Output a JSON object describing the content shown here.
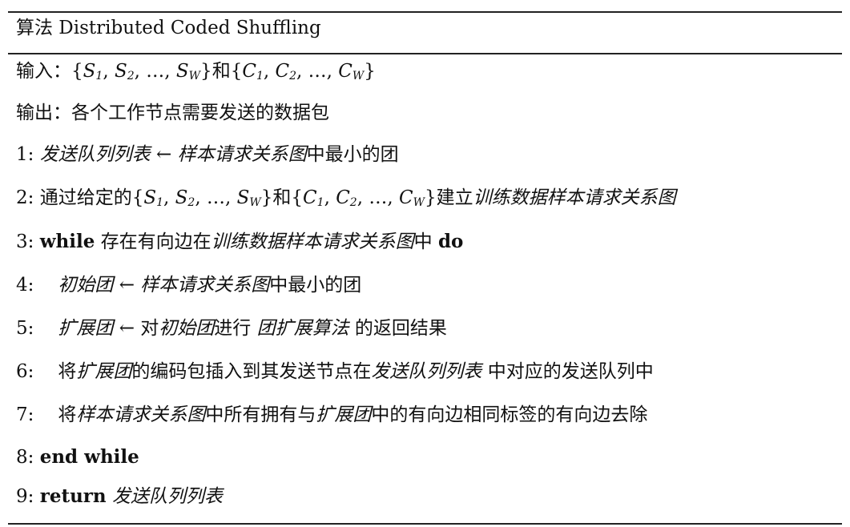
{
  "title": "算法 Distributed Coded Shuffling",
  "input_label": "输入：",
  "and": "和",
  "set_s": {
    "open": "{",
    "s1": "S",
    "sub1": "1",
    "s2": "S",
    "sub2": "2",
    "dots": "…",
    "sw": "S",
    "subw": "W",
    "close": "}"
  },
  "set_c": {
    "open": "{",
    "c1": "C",
    "sub1": "1",
    "c2": "C",
    "sub2": "2",
    "dots": "…",
    "cw": "C",
    "subw": "W",
    "close": "}"
  },
  "output_text": "输出：各个工作节点需要发送的数据包",
  "lines": {
    "l1_num": "1: ",
    "l1_a": "发送队列列表",
    "l1_arrow": " ← ",
    "l1_b": "样本请求关系图",
    "l1_c": "中最小的团",
    "l2_num": "2: ",
    "l2_a": "通过给定的",
    "l2_b": "建立",
    "l2_c": "训练数据样本请求关系图",
    "l3_num": "3: ",
    "l3_kw": "while",
    "l3_a": " 存在有向边在",
    "l3_b": "训练数据样本请求关系图",
    "l3_c": "中 ",
    "l3_do": "do",
    "l4_num": "4:",
    "l4_a": "初始团",
    "l4_arrow": " ← ",
    "l4_b": "样本请求关系图",
    "l4_c": "中最小的团",
    "l5_num": "5:",
    "l5_a": "扩展团",
    "l5_arrow": " ← ",
    "l5_b": "对",
    "l5_c": "初始团",
    "l5_d": "进行 ",
    "l5_e": "团扩展算法",
    "l5_f": " 的返回结果",
    "l6_num": "6:",
    "l6_a": "将",
    "l6_b": "扩展团",
    "l6_c": "的编码包插入到其发送节点在",
    "l6_d": "发送队列列表",
    "l6_e": " 中对应的发送队列中",
    "l7_num": "7:",
    "l7_a": "将",
    "l7_b": "样本请求关系图",
    "l7_c": "中所有拥有与",
    "l7_d": "扩展团",
    "l7_e": "中的有向边相同标签的有向边去除",
    "l8_num": "8: ",
    "l8_kw": "end while",
    "l9_num": "9: ",
    "l9_kw": "return",
    "l9_a": " 发送队列列表"
  }
}
